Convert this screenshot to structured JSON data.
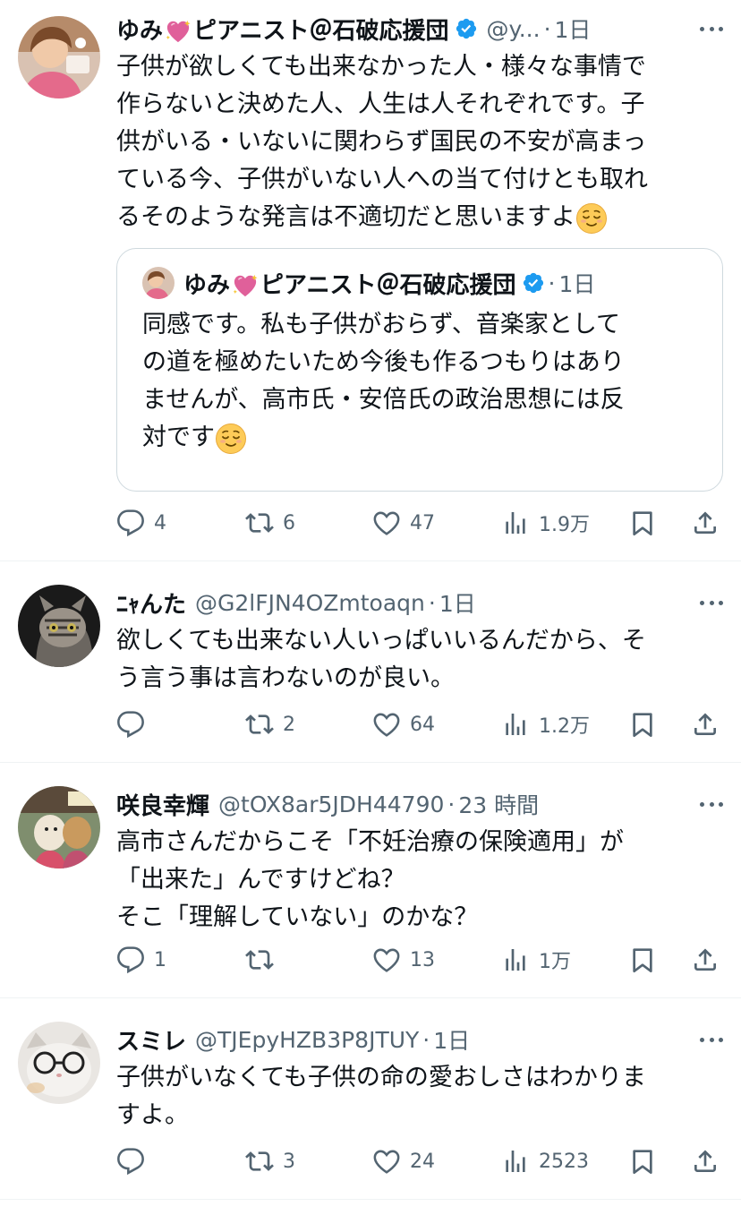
{
  "tweets": [
    {
      "name": "ゆみ💖ピアニスト＠石破応援団",
      "name_pre": "ゆみ",
      "name_post": "ピアニスト＠石破応援団",
      "handle": "@y...",
      "time": "1日",
      "text": "子供が欲しくても出来なかった人・様々な事情で\n作らないと決めた人、人生は人それぞれです。子\n供がいる・いないに関わらず国民の不安が高まっ\nている今、子供がいない人への当て付けとも取れ\nるそのような発言は不適切だと思いますよ",
      "quote": {
        "name_pre": "ゆみ",
        "name_post": "ピアニスト＠石破応援団",
        "time": "1日",
        "text": "同感です。私も子供がおらず、音楽家として\nの道を極めたいため今後も作るつもりはあり\nませんが、高市氏・安倍氏の政治思想には反\n対です"
      },
      "replies": "4",
      "retweets": "6",
      "likes": "47",
      "views": "1.9万"
    },
    {
      "name": "ﾆｬんた",
      "handle": "@G2lFJN4OZmtoaqn",
      "time": "1日",
      "text": "欲しくても出来ない人いっぱいいるんだから、そ\nう言う事は言わないのが良い。",
      "replies": "",
      "retweets": "2",
      "likes": "64",
      "views": "1.2万"
    },
    {
      "name": "咲良幸輝",
      "handle": "@tOX8ar5JDH44790",
      "time": "23 時間",
      "text": "高市さんだからこそ「不妊治療の保険適用」が\n「出来た」んですけどね？\nそこ「理解していない」のかな？",
      "replies": "1",
      "retweets": "",
      "likes": "13",
      "views": "1万"
    },
    {
      "name": "スミレ",
      "handle": "@TJEpyHZB3P8JTUY",
      "time": "1日",
      "text": "子供がいなくても子供の命の愛おしさはわかりま\nすよ。",
      "replies": "",
      "retweets": "3",
      "likes": "24",
      "views": "2523"
    }
  ],
  "colors": {
    "verified": "#1d9bf0",
    "secondary_text": "#536471",
    "divider": "#eff3f4"
  },
  "icons": [
    "reply-icon",
    "retweet-icon",
    "like-icon",
    "views-icon",
    "bookmark-icon",
    "share-icon",
    "more-icon",
    "verified-icon",
    "sparkling-heart-emoji",
    "relieved-face-emoji"
  ]
}
